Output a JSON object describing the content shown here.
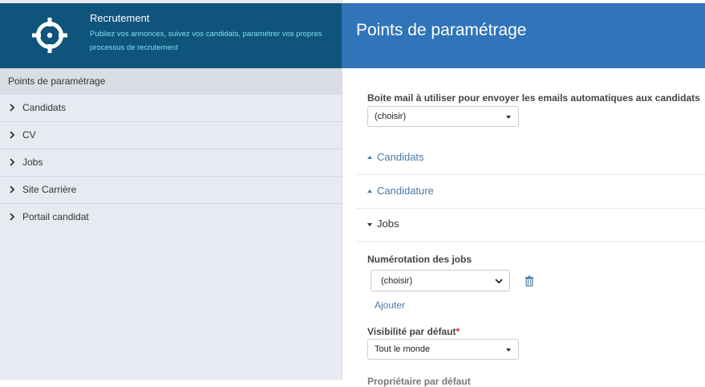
{
  "app": {
    "title": "Recrutement",
    "description": "Publiez vos annonces, suivez vos candidats, paramétrer vos propres processus de recrutement"
  },
  "sidebar": {
    "section_title": "Points de paramétrage",
    "items": [
      {
        "label": "Candidats"
      },
      {
        "label": "CV"
      },
      {
        "label": "Jobs"
      },
      {
        "label": "Site Carrière"
      },
      {
        "label": "Portail candidat"
      }
    ]
  },
  "main": {
    "title": "Points de paramétrage",
    "mailbox": {
      "label": "Boite mail à utiliser pour envoyer les emails automatiques aux candidats",
      "value": "(choisir)"
    },
    "sections": [
      {
        "label": "Candidats",
        "expanded": false
      },
      {
        "label": "Candidature",
        "expanded": false
      },
      {
        "label": "Jobs",
        "expanded": true
      }
    ],
    "jobs": {
      "numbering_label": "Numérotation des jobs",
      "numbering_value": "(choisir)",
      "add_label": "Ajouter",
      "visibility_label": "Visibilité par défaut",
      "visibility_required": "*",
      "visibility_value": "Tout le monde",
      "next_label_partial": "Propriétaire par défaut"
    }
  },
  "colors": {
    "sidebar_header": "#0f547b",
    "main_header": "#3075b9",
    "accent_text": "#7fe0f0",
    "link": "#4a7aa6"
  }
}
